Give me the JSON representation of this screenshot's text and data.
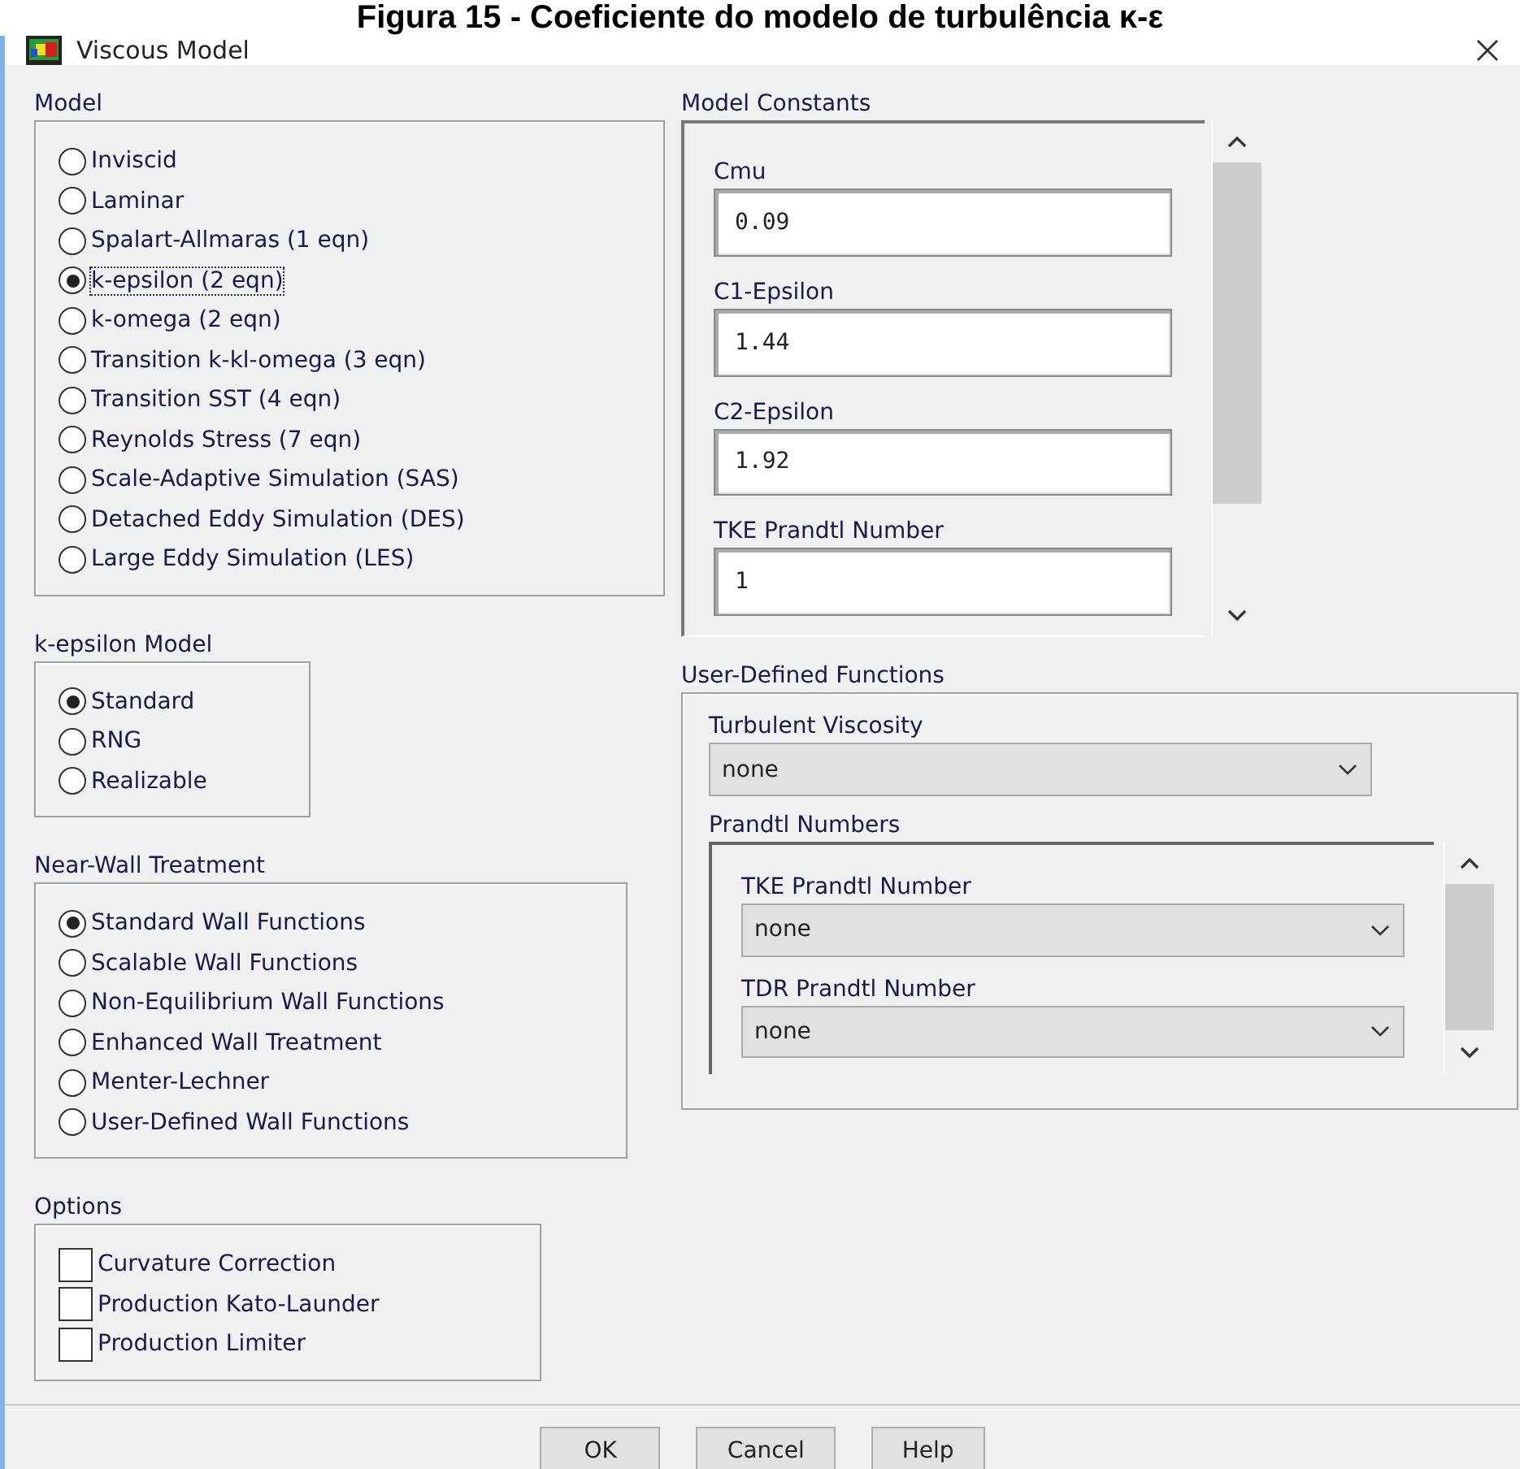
{
  "caption": "Figura 15 - Coeficiente do modelo de turbulência κ-ε",
  "window": {
    "title": "Viscous Model"
  },
  "model": {
    "label": "Model",
    "options": [
      {
        "label": "Inviscid",
        "selected": false,
        "focused": false
      },
      {
        "label": "Laminar",
        "selected": false,
        "focused": false
      },
      {
        "label": "Spalart-Allmaras (1 eqn)",
        "selected": false,
        "focused": false
      },
      {
        "label": "k-epsilon (2 eqn)",
        "selected": true,
        "focused": true
      },
      {
        "label": "k-omega (2 eqn)",
        "selected": false,
        "focused": false
      },
      {
        "label": "Transition k-kl-omega (3 eqn)",
        "selected": false,
        "focused": false
      },
      {
        "label": "Transition SST (4 eqn)",
        "selected": false,
        "focused": false
      },
      {
        "label": "Reynolds Stress (7 eqn)",
        "selected": false,
        "focused": false
      },
      {
        "label": "Scale-Adaptive Simulation (SAS)",
        "selected": false,
        "focused": false
      },
      {
        "label": "Detached Eddy Simulation (DES)",
        "selected": false,
        "focused": false
      },
      {
        "label": "Large Eddy Simulation (LES)",
        "selected": false,
        "focused": false
      }
    ]
  },
  "k_epsilon_model": {
    "label": "k-epsilon Model",
    "options": [
      {
        "label": "Standard",
        "selected": true
      },
      {
        "label": "RNG",
        "selected": false
      },
      {
        "label": "Realizable",
        "selected": false
      }
    ]
  },
  "near_wall_treatment": {
    "label": "Near-Wall Treatment",
    "options": [
      {
        "label": "Standard Wall Functions",
        "selected": true
      },
      {
        "label": "Scalable Wall Functions",
        "selected": false
      },
      {
        "label": "Non-Equilibrium Wall Functions",
        "selected": false
      },
      {
        "label": "Enhanced Wall Treatment",
        "selected": false
      },
      {
        "label": "Menter-Lechner",
        "selected": false
      },
      {
        "label": "User-Defined Wall Functions",
        "selected": false
      }
    ]
  },
  "options": {
    "label": "Options",
    "items": [
      {
        "label": "Curvature Correction",
        "checked": false
      },
      {
        "label": "Production Kato-Launder",
        "checked": false
      },
      {
        "label": "Production Limiter",
        "checked": false
      }
    ]
  },
  "model_constants": {
    "label": "Model Constants",
    "fields": [
      {
        "label": "Cmu",
        "value": "0.09"
      },
      {
        "label": "C1-Epsilon",
        "value": "1.44"
      },
      {
        "label": "C2-Epsilon",
        "value": "1.92"
      },
      {
        "label": "TKE Prandtl Number",
        "value": "1"
      }
    ]
  },
  "user_defined_functions": {
    "label": "User-Defined Functions",
    "turbulent_viscosity": {
      "label": "Turbulent Viscosity",
      "value": "none"
    },
    "prandtl_numbers": {
      "label": "Prandtl Numbers",
      "fields": [
        {
          "label": "TKE Prandtl Number",
          "value": "none"
        },
        {
          "label": "TDR Prandtl Number",
          "value": "none"
        }
      ]
    }
  },
  "buttons": [
    "OK",
    "Cancel",
    "Help"
  ]
}
